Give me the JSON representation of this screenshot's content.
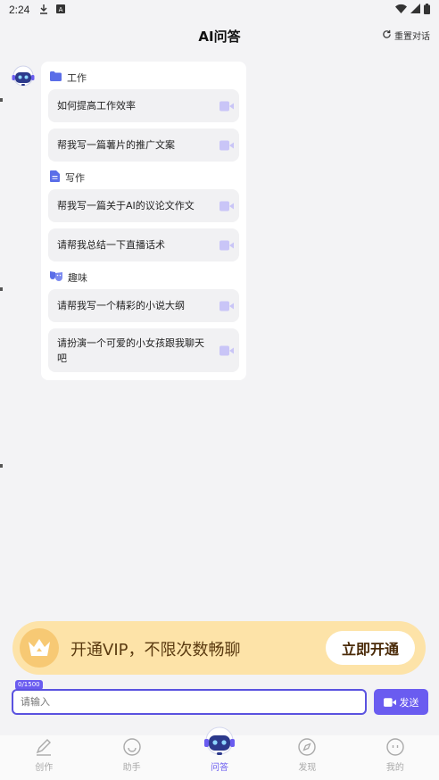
{
  "status_bar": {
    "time": "2:24"
  },
  "header": {
    "title": "AI问答",
    "reset_label": "重置对话"
  },
  "sections": [
    {
      "title": "工作",
      "icon": "folder-icon",
      "items": [
        "如何提高工作效率",
        "帮我写一篇薯片的推广文案"
      ]
    },
    {
      "title": "写作",
      "icon": "document-icon",
      "items": [
        "帮我写一篇关于AI的议论文作文",
        "请帮我总结一下直播话术"
      ]
    },
    {
      "title": "趣味",
      "icon": "masks-icon",
      "items": [
        "请帮我写一个精彩的小说大纲",
        "请扮演一个可爱的小女孩跟我聊天吧"
      ]
    }
  ],
  "vip": {
    "text": "开通VIP，不限次数畅聊",
    "button": "立即开通"
  },
  "input": {
    "counter": "0/1500",
    "placeholder": "请输入",
    "send_label": "发送"
  },
  "nav": [
    {
      "label": "创作",
      "icon": "pen-icon"
    },
    {
      "label": "助手",
      "icon": "smile-icon"
    },
    {
      "label": "问答",
      "icon": "robot-icon"
    },
    {
      "label": "发现",
      "icon": "compass-icon"
    },
    {
      "label": "我的",
      "icon": "face-icon"
    }
  ],
  "colors": {
    "accent": "#6a5cf0",
    "vip_bg": "#fde3a8",
    "vip_text": "#5a3a10"
  }
}
